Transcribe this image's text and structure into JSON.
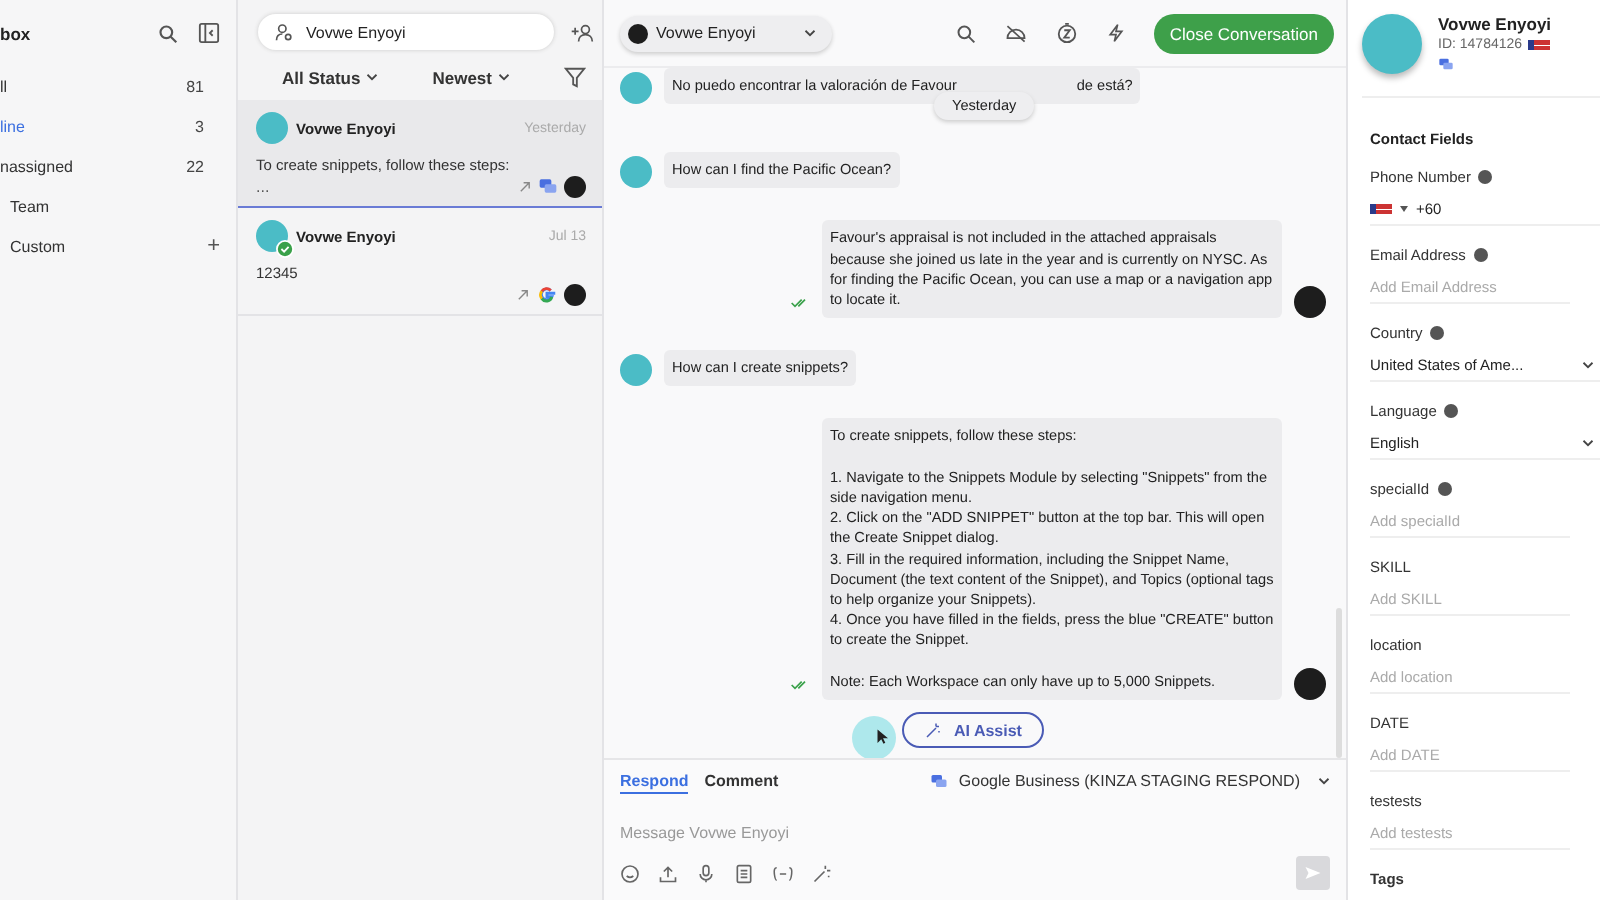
{
  "nav": {
    "title": "box",
    "items": [
      {
        "label": "ll",
        "count": "81",
        "selected": false,
        "kind": "count"
      },
      {
        "label": "line",
        "count": "3",
        "selected": true,
        "kind": "count"
      },
      {
        "label": "nassigned",
        "count": "22",
        "selected": false,
        "kind": "count"
      },
      {
        "label": "Team",
        "selected": false,
        "kind": "group"
      },
      {
        "label": "Custom",
        "selected": false,
        "kind": "group",
        "add": "+"
      }
    ]
  },
  "list": {
    "search": "Vovwe Enyoyi",
    "status_filter": "All Status",
    "sort": "Newest",
    "items": [
      {
        "name": "Vovwe Enyoyi",
        "time": "Yesterday",
        "preview": "To create snippets, follow these steps:",
        "preview_more": "...",
        "selected": true,
        "verified": false,
        "kind": "chat"
      },
      {
        "name": "Vovwe Enyoyi",
        "time": "Jul 13",
        "preview": "12345",
        "selected": false,
        "verified": true,
        "kind": "google"
      }
    ]
  },
  "chat": {
    "contact": "Vovwe Enyoyi",
    "close_button": "Close Conversation",
    "date_pill": "Yesterday",
    "messages": [
      {
        "kind": "incoming",
        "text": "No puedo encontrar la valoración de Favour",
        "text_after": "de está?"
      },
      {
        "kind": "incoming",
        "text": "How can I find the Pacific Ocean?"
      },
      {
        "kind": "outgoing",
        "text": "Favour's appraisal is not included in the attached appraisals because she joined us late in the year and is currently on NYSC. As for finding the Pacific Ocean, you can use a map or a navigation app to locate it."
      },
      {
        "kind": "incoming",
        "text": "How can I create snippets?"
      },
      {
        "kind": "outgoing",
        "text": "To create snippets, follow these steps:\n\n1. Navigate to the Snippets Module by selecting \"Snippets\" from the side navigation menu.\n2. Click on the \"ADD SNIPPET\" button at the top bar. This will open the Create Snippet dialog.\n3. Fill in the required information, including the Snippet Name, Document (the text content of the Snippet), and Topics (optional tags to help organize your Snippets).\n4. Once you have filled in the fields, press the blue \"CREATE\" button to create the Snippet.\n\nNote: Each Workspace can only have up to 5,000 Snippets."
      }
    ],
    "ai_assist": "AI Assist",
    "composer": {
      "tabs": [
        {
          "label": "Respond",
          "selected": true
        },
        {
          "label": "Comment",
          "selected": false
        }
      ],
      "channel": "Google Business (KINZA STAGING RESPOND)",
      "placeholder": "Message Vovwe Enyoyi"
    }
  },
  "contact": {
    "name": "Vovwe Enyoyi",
    "id": "ID: 14784126",
    "section": "Contact Fields",
    "fields": [
      {
        "label": "Phone Number",
        "help": true,
        "kind": "phone",
        "value": "+60"
      },
      {
        "label": "Email Address",
        "help": true,
        "kind": "text",
        "placeholder": "Add Email Address"
      },
      {
        "label": "Country",
        "help": true,
        "kind": "select",
        "value": "United States of Ame..."
      },
      {
        "label": "Language",
        "help": true,
        "kind": "select",
        "value": "English"
      },
      {
        "label": "specialId",
        "help": true,
        "kind": "text",
        "placeholder": "Add specialId"
      },
      {
        "label": "SKILL",
        "help": false,
        "kind": "text",
        "placeholder": "Add SKILL"
      },
      {
        "label": "location",
        "help": false,
        "kind": "text",
        "placeholder": "Add location"
      },
      {
        "label": "DATE",
        "help": false,
        "kind": "text",
        "placeholder": "Add DATE"
      },
      {
        "label": "testests",
        "help": false,
        "kind": "text",
        "placeholder": "Add testests"
      }
    ],
    "tags_label": "Tags"
  }
}
